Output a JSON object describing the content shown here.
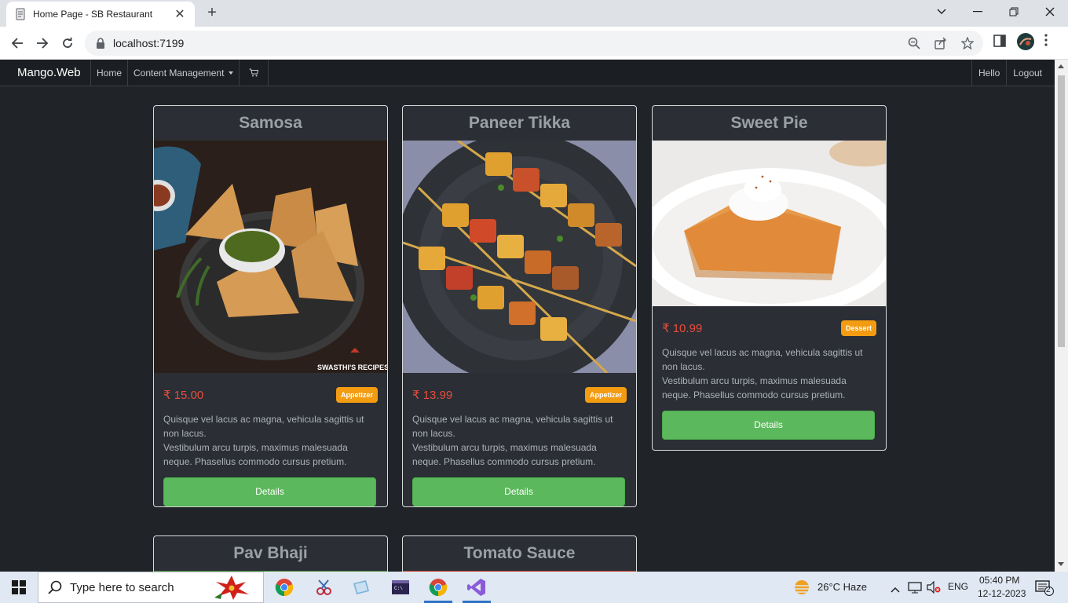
{
  "browser": {
    "tab_title": "Home Page - SB Restaurant",
    "url": "localhost:7199"
  },
  "app": {
    "brand": "Mango.Web",
    "nav": {
      "home": "Home",
      "content_management": "Content Management",
      "hello": "Hello",
      "logout": "Logout"
    }
  },
  "products": [
    {
      "name": "Samosa",
      "price": "₹ 15.00",
      "category": "Appetizer",
      "description_1": "Quisque vel lacus ac magna, vehicula sagittis ut non lacus.",
      "description_2": "Vestibulum arcu turpis, maximus malesuada neque. Phasellus commodo cursus pretium.",
      "image_watermark": "SWASTHI'S RECIPES",
      "button": "Details"
    },
    {
      "name": "Paneer Tikka",
      "price": "₹ 13.99",
      "category": "Appetizer",
      "description_1": "Quisque vel lacus ac magna, vehicula sagittis ut non lacus.",
      "description_2": "Vestibulum arcu turpis, maximus malesuada neque. Phasellus commodo cursus pretium.",
      "button": "Details"
    },
    {
      "name": "Sweet Pie",
      "price": "₹ 10.99",
      "category": "Dessert",
      "description_1": "Quisque vel lacus ac magna, vehicula sagittis ut non lacus.",
      "description_2": "Vestibulum arcu turpis, maximus malesuada neque. Phasellus commodo cursus pretium.",
      "button": "Details"
    },
    {
      "name": "Pav Bhaji"
    },
    {
      "name": "Tomato Sauce"
    }
  ],
  "taskbar": {
    "search_placeholder": "Type here to search",
    "weather": "26°C  Haze",
    "language": "ENG",
    "time": "05:40 PM",
    "date": "12-12-2023",
    "notification_count": "2"
  }
}
